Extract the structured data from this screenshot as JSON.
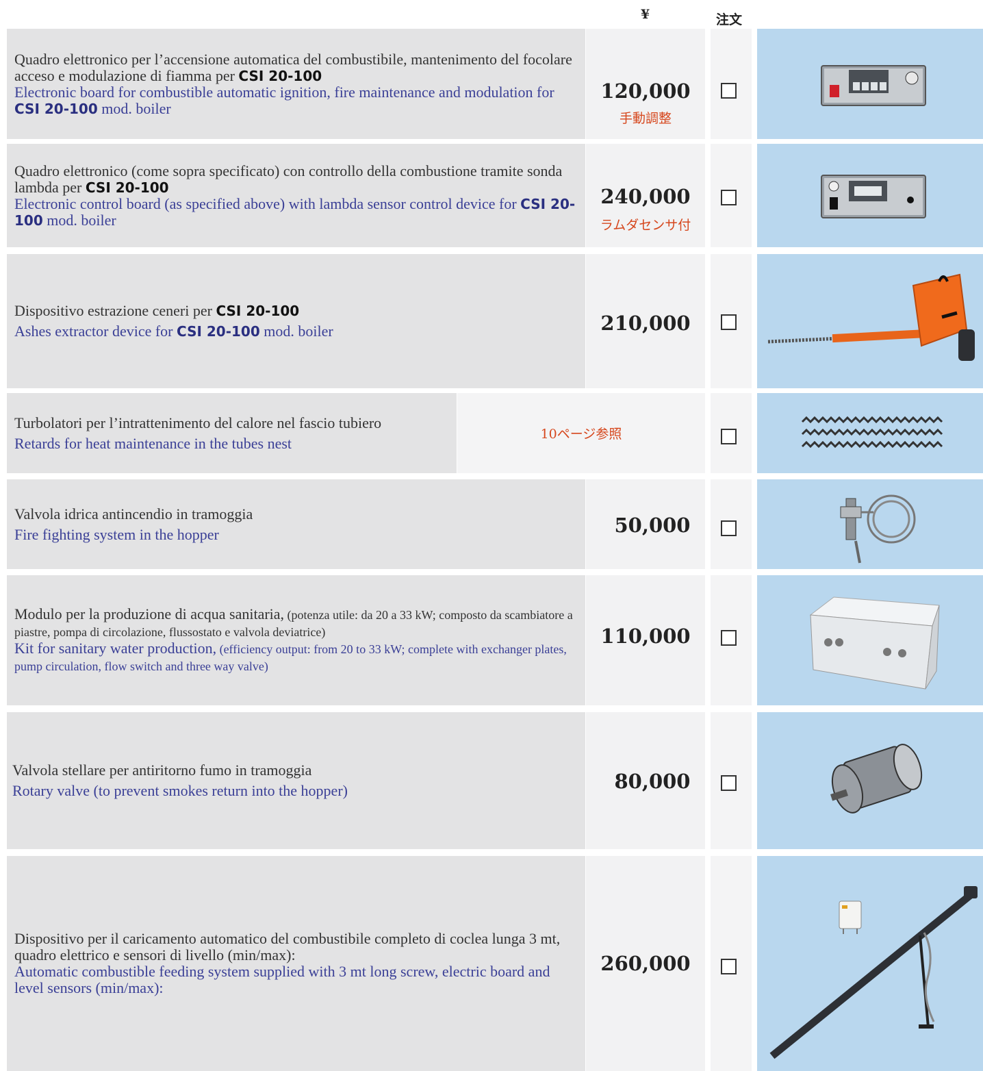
{
  "header": {
    "currency": "¥",
    "order": "注文"
  },
  "rows": [
    {
      "it_text": "Quadro elettronico per l’accensione automatica del combustibile, mantenimento del focolare acceso e modulazione di fiamma per ",
      "it_bold": "CSI 20-100",
      "en_text": "Electronic board for combustible automatic ignition, fire maintenance and modulation for ",
      "en_bold": "CSI 20-100",
      "en_tail": " mod. boiler",
      "price": "120,000",
      "note": "手動調整",
      "image": "control-panel-manual"
    },
    {
      "it_text": "Quadro elettronico (come sopra specificato) con controllo della combustione tramite sonda lambda per ",
      "it_bold": "CSI 20-100",
      "en_text": "Electronic control board (as specified above) with lambda sensor control device for ",
      "en_bold": "CSI 20-100",
      "en_tail": " mod. boiler",
      "price": "240,000",
      "note": "ラムダセンサ付",
      "image": "control-panel-lambda"
    },
    {
      "it_text": "Dispositivo estrazione ceneri per ",
      "it_bold": "CSI 20-100",
      "en_text": "Ashes extractor device for ",
      "en_bold": "CSI 20-100",
      "en_tail": " mod. boiler",
      "price": "210,000",
      "image": "ash-extractor"
    },
    {
      "it_text": "Turbolatori per l’intrattenimento del calore nel fascio tubiero",
      "en_text": "Retards for heat maintenance in the tubes nest",
      "note": "10ページ参照",
      "image": "turbulators"
    },
    {
      "it_text": "Valvola idrica antincendio in tramoggia",
      "en_text": "Fire fighting system in the hopper",
      "price": "50,000",
      "image": "fire-valve"
    },
    {
      "it_text": "Modulo per la produzione di acqua sanitaria,",
      "it_small": " (potenza utile: da 20 a 33 kW; composto da scambiatore a piastre, pompa di circolazione, flussostato e valvola deviatrice)",
      "en_text": "Kit for sanitary water production,",
      "en_small": " (efficiency output: from 20 to 33 kW; complete with exchanger plates, pump circulation, flow switch and three way valve)",
      "price": "110,000",
      "image": "water-module"
    },
    {
      "it_text": "Valvola stellare per antiritorno fumo in tramoggia",
      "en_text": "Rotary valve (to prevent smokes return into the hopper)",
      "price": "80,000",
      "image": "rotary-valve"
    },
    {
      "it_text": "Dispositivo per il caricamento automatico del combustibile completo di coclea lunga 3 mt, quadro elettrico e sensori di livello (min/max):",
      "en_text": "Automatic combustible feeding system supplied with 3 mt long screw, electric board and level sensors (min/max):",
      "price": "260,000",
      "image": "feeding-screw"
    }
  ]
}
